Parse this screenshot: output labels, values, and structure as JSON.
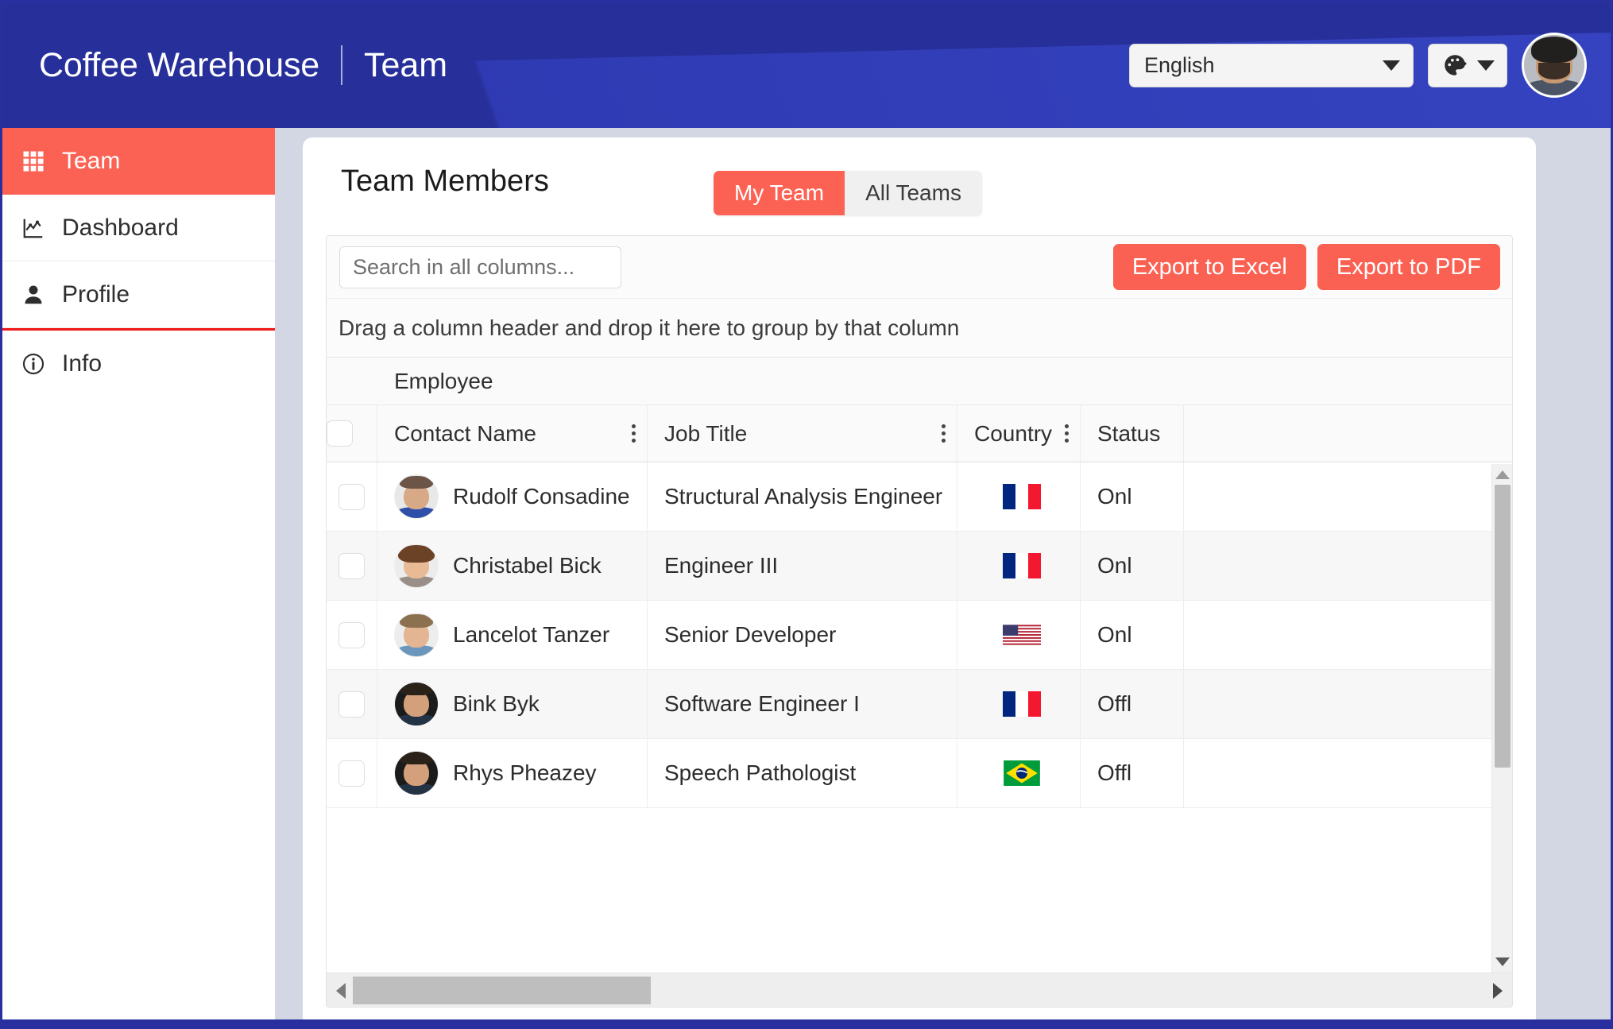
{
  "header": {
    "app_title": "Coffee Warehouse",
    "page_title": "Team",
    "language_value": "English",
    "language_placeholder": "English",
    "theme_icon": "palette-icon",
    "avatar_label": "user-avatar"
  },
  "sidebar": {
    "items": [
      {
        "label": "Team",
        "icon": "grid-icon",
        "active": true
      },
      {
        "label": "Dashboard",
        "icon": "chart-icon",
        "active": false
      },
      {
        "label": "Profile",
        "icon": "person-icon",
        "active": false
      },
      {
        "label": "Info",
        "icon": "info-circle-icon",
        "active": false
      }
    ]
  },
  "main": {
    "card_title": "Team Members",
    "toggle": {
      "active_label": "My Team",
      "inactive_label": "All Teams"
    },
    "search_placeholder": "Search in all columns...",
    "export_excel": "Export to Excel",
    "export_pdf": "Export to PDF",
    "group_panel_text": "Drag a column header and drop it here to group by that column",
    "group_header": "Employee",
    "columns": [
      {
        "key": "contact_name",
        "label": "Contact Name",
        "menu": true
      },
      {
        "key": "job_title",
        "label": "Job Title",
        "menu": true
      },
      {
        "key": "country",
        "label": "Country",
        "menu": true
      },
      {
        "key": "status",
        "label": "Status",
        "menu": false
      }
    ],
    "rows": [
      {
        "contact_name": "Rudolf Consadine",
        "job_title": "Structural Analysis Engineer",
        "country": "France",
        "flag": "fr",
        "status": "Onl",
        "avatar": "avatar-male-1"
      },
      {
        "contact_name": "Christabel Bick",
        "job_title": "Engineer III",
        "country": "France",
        "flag": "fr",
        "status": "Onl",
        "avatar": "avatar-female-1"
      },
      {
        "contact_name": "Lancelot Tanzer",
        "job_title": "Senior Developer",
        "country": "United States",
        "flag": "us",
        "status": "Onl",
        "avatar": "avatar-male-2"
      },
      {
        "contact_name": "Bink Byk",
        "job_title": "Software Engineer I",
        "country": "France",
        "flag": "fr",
        "status": "Offl",
        "avatar": "avatar-male-3"
      },
      {
        "contact_name": "Rhys Pheazey",
        "job_title": "Speech Pathologist",
        "country": "Brazil",
        "flag": "br",
        "status": "Offl",
        "avatar": "avatar-male-3"
      }
    ]
  },
  "colors": {
    "brand_blue": "#27309a",
    "accent_coral": "#fc6254",
    "content_bg": "#d3d7e4",
    "divider_red": "#f21616"
  }
}
